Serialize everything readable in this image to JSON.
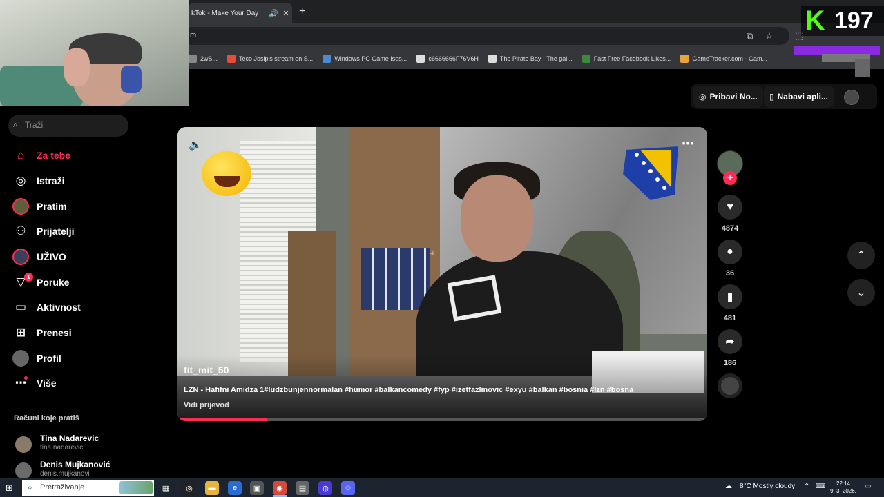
{
  "browser": {
    "tab_title": "kTok - Make Your Day",
    "address_fragment": "m",
    "bookmarks": [
      {
        "label": "2wS...",
        "color": "#888888"
      },
      {
        "label": "Teco Josip's stream on S...",
        "color": "#e84b3a"
      },
      {
        "label": "Windows PC Game Isos...",
        "color": "#4a8ad4"
      },
      {
        "label": "c6666666F76V6H",
        "color": "#dddddd"
      },
      {
        "label": "The Pirate Bay - The gal...",
        "color": "#dddddd"
      },
      {
        "label": "Fast Free Facebook Likes...",
        "color": "#3b8a3b"
      },
      {
        "label": "GameTracker.com - Gam...",
        "color": "#e8a33a"
      }
    ]
  },
  "overlay": {
    "k_logo": "K",
    "viewer_count": "197"
  },
  "header": {
    "get_coins_label": "Pribavi No...",
    "get_app_label": "Nabavi apli..."
  },
  "sidebar": {
    "search_placeholder": "Traži",
    "items": [
      {
        "label": "Za tebe",
        "icon": "home-icon",
        "active": true
      },
      {
        "label": "Istraži",
        "icon": "compass-icon"
      },
      {
        "label": "Pratim",
        "icon": "following-avatar"
      },
      {
        "label": "Prijatelji",
        "icon": "friends-icon"
      },
      {
        "label": "UŽIVO",
        "icon": "live-avatar"
      },
      {
        "label": "Poruke",
        "icon": "inbox-icon",
        "badge": "1"
      },
      {
        "label": "Aktivnost",
        "icon": "activity-icon"
      },
      {
        "label": "Prenesi",
        "icon": "upload-icon"
      },
      {
        "label": "Profil",
        "icon": "profile-avatar"
      },
      {
        "label": "Više",
        "icon": "more-icon"
      }
    ],
    "accounts_title": "Računi koje pratiš",
    "accounts": [
      {
        "name": "Tina Nadarevic",
        "handle": "tina.nadarevic"
      },
      {
        "name": "Denis Mujkanović",
        "handle": "denis.mujkanovi"
      }
    ]
  },
  "video": {
    "author": "fit_mit_50",
    "description": "LZN - Hafifni Amidza 1#ludzbunjennormalan #humor #balkancomedy #fyp #izetfazlinovic #exyu #balkan #bosnia #lzn #bosna",
    "translate_label": "Vidi prijevod",
    "progress": 0.17
  },
  "actions": {
    "likes": "4874",
    "comments": "36",
    "saves": "481",
    "shares": "186"
  },
  "taskbar": {
    "search_placeholder": "Pretraživanje",
    "weather": "8°C  Mostly cloudy",
    "time": "22:14",
    "date": "9. 3. 2026."
  },
  "colors": {
    "accent": "#fe2c55",
    "kick_green": "#53fc18"
  }
}
